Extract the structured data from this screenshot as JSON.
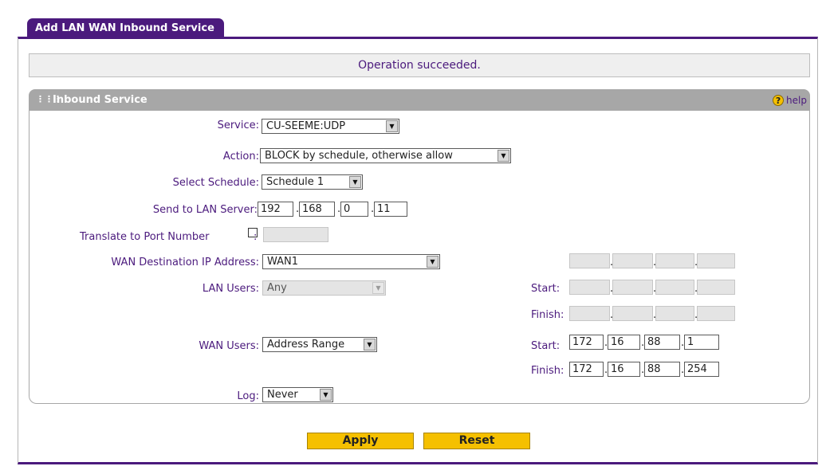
{
  "tab_title": "Add LAN WAN Inbound Service",
  "status_message": "Operation succeeded.",
  "section": {
    "title": "Inbound Service",
    "help_label": "help"
  },
  "colors": {
    "accent": "#4b1a7d",
    "button": "#f5c000",
    "header_gray": "#a7a7a7"
  },
  "form": {
    "service": {
      "label": "Service:",
      "value": "CU-SEEME:UDP"
    },
    "action": {
      "label": "Action:",
      "value": "BLOCK by schedule, otherwise allow"
    },
    "schedule": {
      "label": "Select Schedule:",
      "value": "Schedule 1"
    },
    "lan_server": {
      "label": "Send to LAN Server:",
      "octets": [
        "192",
        "168",
        "0",
        "11"
      ]
    },
    "translate_port": {
      "label": "Translate to Port Number",
      "colon": ":",
      "checked": false,
      "value": ""
    },
    "wan_destination": {
      "label": "WAN Destination IP Address:",
      "value": "WAN1"
    },
    "lan_users": {
      "label": "LAN Users:",
      "value": "Any",
      "start_label": "Start:",
      "finish_label": "Finish:"
    },
    "wan_users": {
      "label": "WAN Users:",
      "value": "Address Range",
      "start_label": "Start:",
      "start_octets": [
        "172",
        "16",
        "88",
        "1"
      ],
      "finish_label": "Finish:",
      "finish_octets": [
        "172",
        "16",
        "88",
        "254"
      ]
    },
    "log": {
      "label": "Log:",
      "value": "Never"
    }
  },
  "buttons": {
    "apply": "Apply",
    "reset": "Reset"
  },
  "icons": {
    "dropdown": "chevron-down-icon",
    "help": "help-icon",
    "grip": "grip-icon"
  }
}
